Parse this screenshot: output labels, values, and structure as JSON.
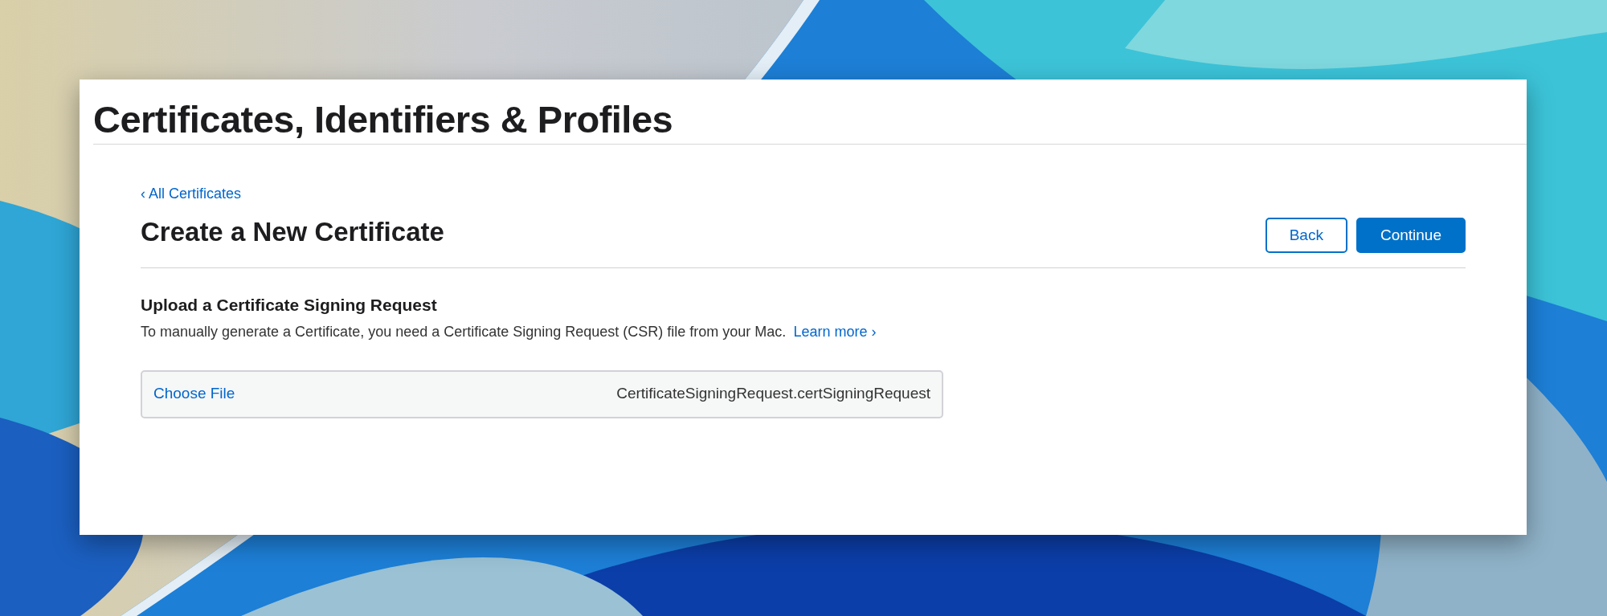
{
  "header": {
    "title": "Certificates, Identifiers & Profiles"
  },
  "back_link": "‹ All Certificates",
  "page_title": "Create a New Certificate",
  "buttons": [
    {
      "label": "Back",
      "kind": "secondary"
    },
    {
      "label": "Continue",
      "kind": "primary"
    }
  ],
  "section": {
    "heading": "Upload a Certificate Signing Request",
    "description": "To manually generate a Certificate, you need a Certificate Signing Request (CSR) file from your Mac.",
    "link": "Learn more ›"
  },
  "file_input": {
    "button": "Choose File",
    "value": "CertificateSigningRequest.certSigningRequest"
  }
}
